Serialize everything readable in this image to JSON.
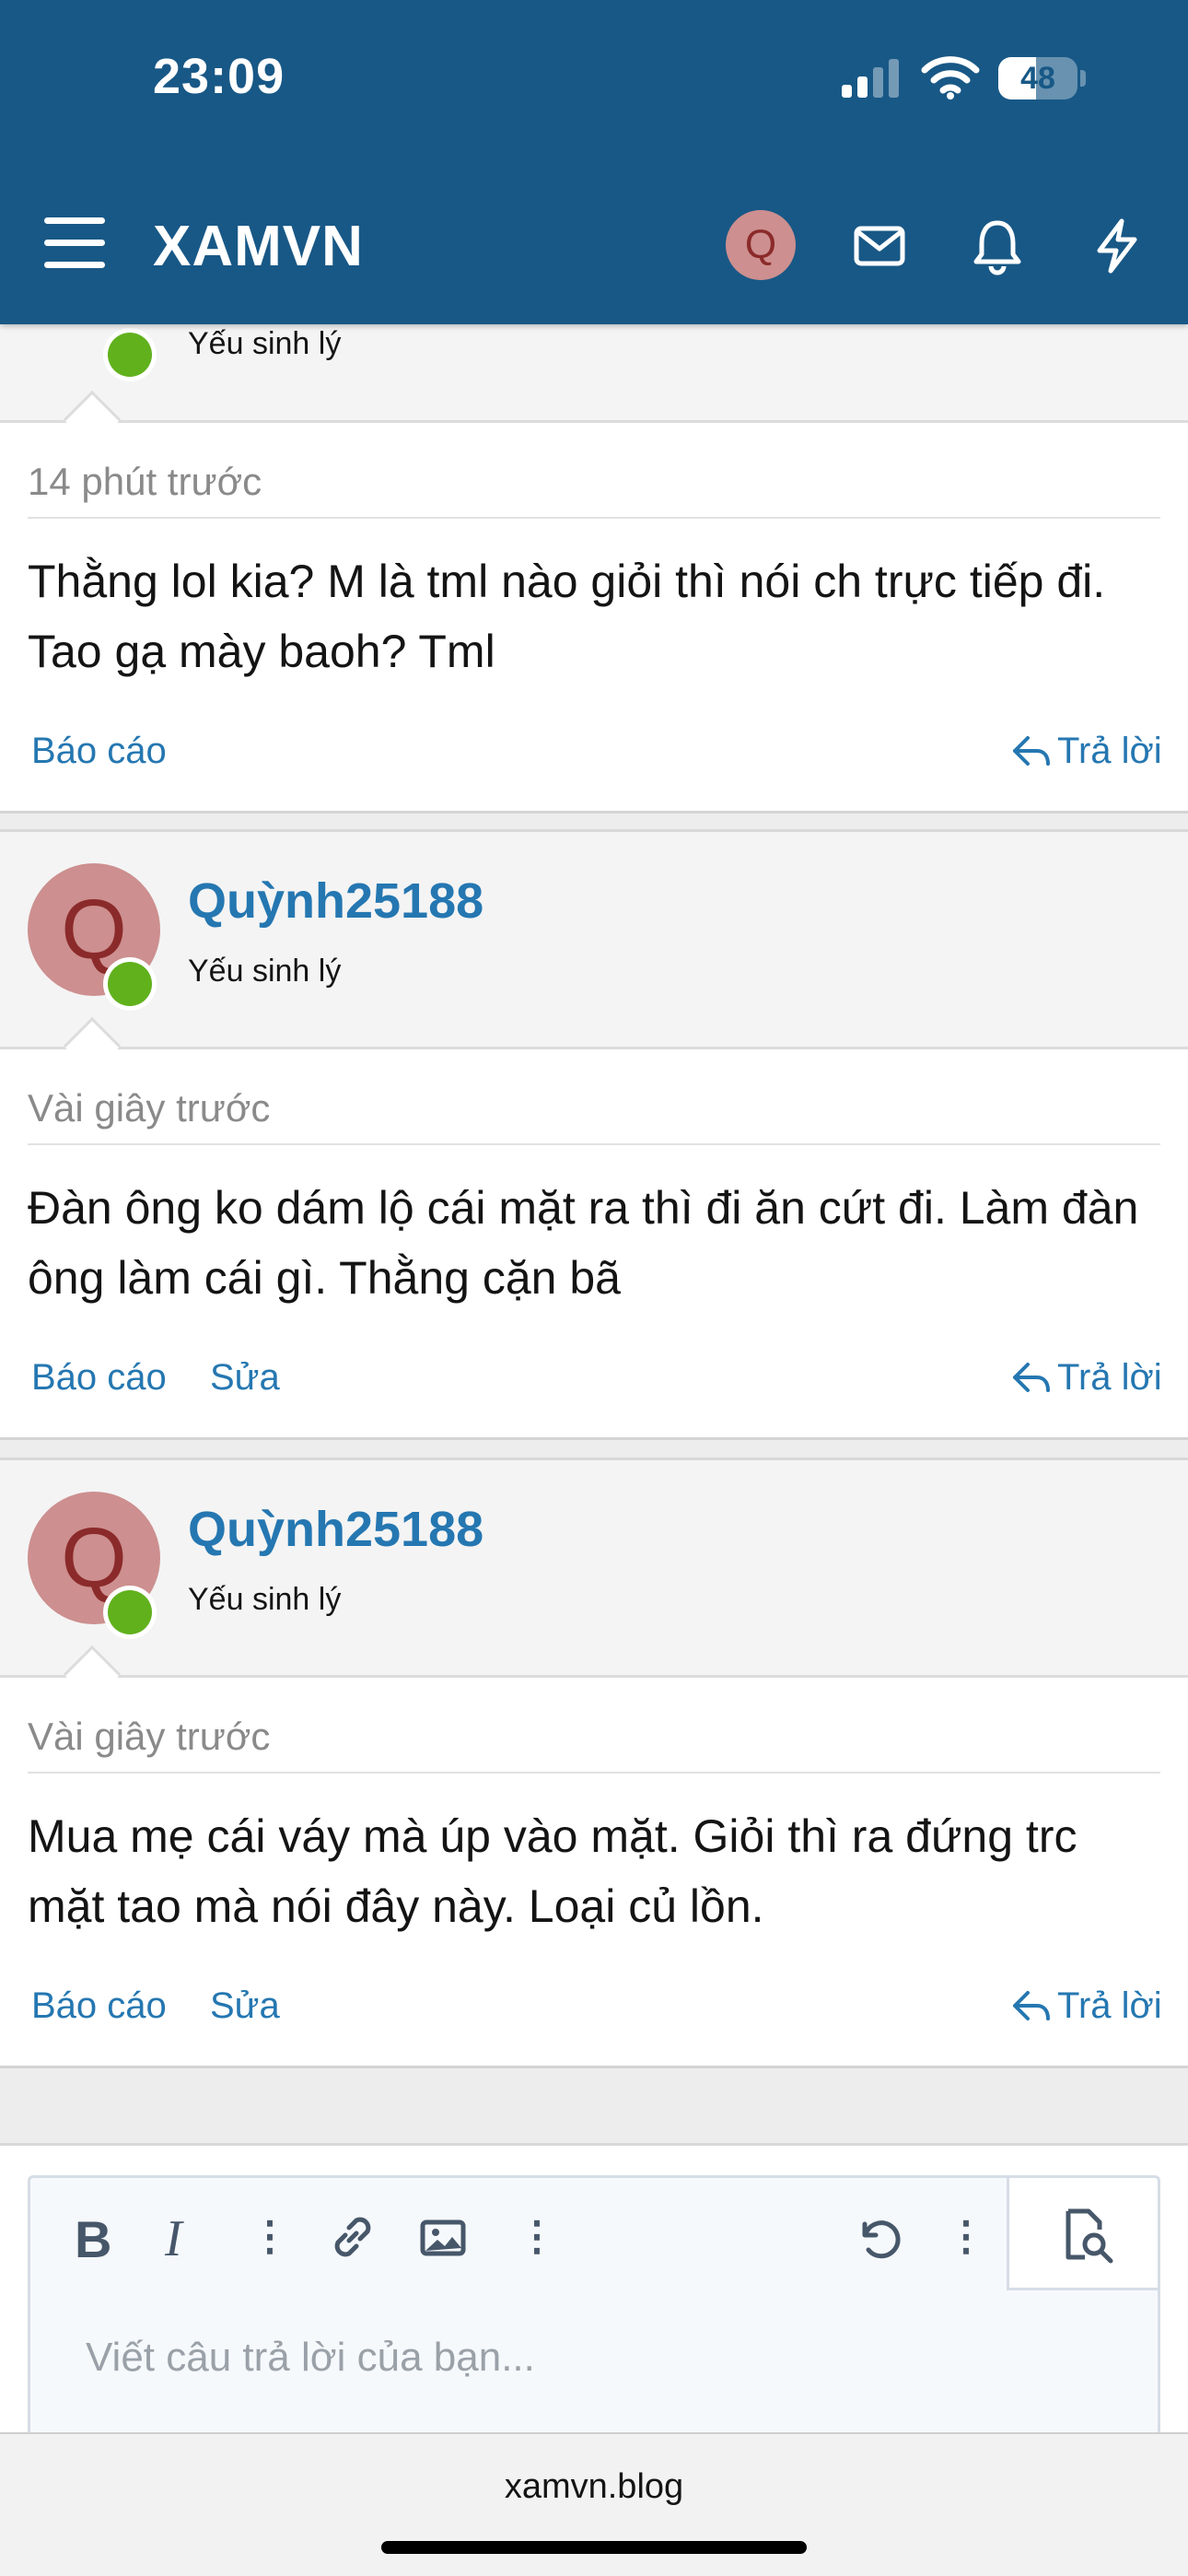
{
  "status_bar": {
    "time": "23:09",
    "battery": "48",
    "battery_level": 0.48
  },
  "header": {
    "menu_icon": "hamburger-icon",
    "brand": "XAMVN",
    "avatar_letter": "Q",
    "icons": [
      "mail-icon",
      "bell-icon",
      "bolt-icon"
    ]
  },
  "first_post": {
    "user_title": "Yếu sinh lý",
    "time": "14 phút trước",
    "message": "Thằng lol kia? M là tml nào giỏi thì nói ch trực tiếp đi. Tao gạ mày baoh? Tml",
    "report": "Báo cáo",
    "reply": "Trả lời"
  },
  "posts": [
    {
      "avatar_letter": "Q",
      "username": "Quỳnh25188",
      "user_title": "Yếu sinh lý",
      "time": "Vài giây trước",
      "message": "Đàn ông ko dám lộ cái mặt ra thì đi ăn cứt đi. Làm đàn ông làm cái gì. Thằng cặn bã",
      "report": "Báo cáo",
      "edit": "Sửa",
      "reply": "Trả lời"
    },
    {
      "avatar_letter": "Q",
      "username": "Quỳnh25188",
      "user_title": "Yếu sinh lý",
      "time": "Vài giây trước",
      "message": "Mua mẹ cái váy mà úp vào mặt. Giỏi thì ra đứng trc mặt tao mà nói đây này. Loại củ lồn.",
      "report": "Báo cáo",
      "edit": "Sửa",
      "reply": "Trả lời"
    }
  ],
  "editor": {
    "bold": "B",
    "italic": "I",
    "placeholder": "Viết câu trả lời của bạn..."
  },
  "browser": {
    "url": "xamvn.blog"
  },
  "colors": {
    "header": "#185886",
    "link": "#2577b1",
    "online": "#61b11d",
    "avatar": "#cd8f8f"
  }
}
